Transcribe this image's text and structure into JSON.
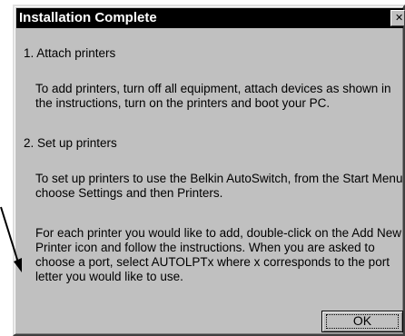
{
  "dialog": {
    "title": "Installation Complete",
    "close_glyph": "✕",
    "step1_heading": "1. Attach printers",
    "step1_body": "To add printers, turn off all equipment, attach devices as shown in the instructions, turn on the printers and boot your PC.",
    "step2_heading": "2. Set up printers",
    "step2_body": "To set up printers to use the Belkin AutoSwitch, from the Start Menu choose Settings and then Printers.",
    "step2_detail": "For each printer you would like to add, double-click on the Add New Printer icon and follow the instructions. When you are asked to choose a port, select AUTOLPTx where x corresponds to the port letter you would like to use.",
    "ok_label": "OK"
  },
  "colors": {
    "dialog_face": "#c0c0c0",
    "titlebar": "#000000",
    "title_text": "#ffffff"
  },
  "icons": {
    "close": "close-icon",
    "pointer": "callout-arrow"
  }
}
